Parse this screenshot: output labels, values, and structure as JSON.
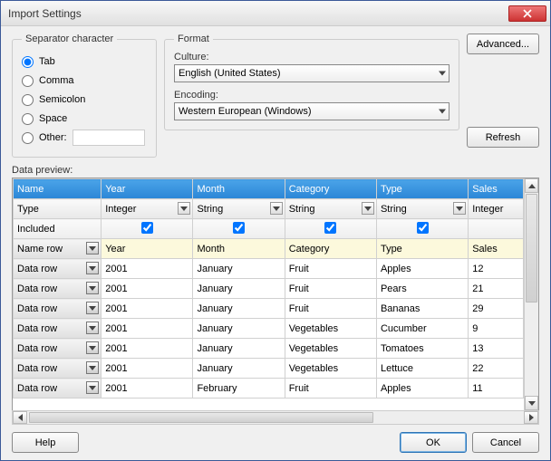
{
  "window": {
    "title": "Import Settings"
  },
  "separator": {
    "legend": "Separator character",
    "options": {
      "tab": "Tab",
      "comma": "Comma",
      "semicolon": "Semicolon",
      "space": "Space",
      "other": "Other:"
    },
    "selected": "tab",
    "other_value": ""
  },
  "format": {
    "legend": "Format",
    "culture_label": "Culture:",
    "culture_value": "English (United States)",
    "encoding_label": "Encoding:",
    "encoding_value": "Western European (Windows)"
  },
  "buttons": {
    "advanced": "Advanced...",
    "refresh": "Refresh",
    "help": "Help",
    "ok": "OK",
    "cancel": "Cancel"
  },
  "preview": {
    "label": "Data preview:",
    "type_row_label": "Type",
    "included_row_label": "Included",
    "columns": [
      {
        "name": "Name",
        "type": "",
        "included": null
      },
      {
        "name": "Year",
        "type": "Integer",
        "included": true
      },
      {
        "name": "Month",
        "type": "String",
        "included": true
      },
      {
        "name": "Category",
        "type": "String",
        "included": true
      },
      {
        "name": "Type",
        "type": "String",
        "included": true
      },
      {
        "name": "Sales",
        "type": "Integer",
        "included": true
      }
    ],
    "rowtype_labels": {
      "name": "Name row",
      "data": "Data row"
    },
    "rows": [
      {
        "rowtype": "Name row",
        "cells": [
          "Year",
          "Month",
          "Category",
          "Type",
          "Sales"
        ],
        "is_name": true
      },
      {
        "rowtype": "Data row",
        "cells": [
          "2001",
          "January",
          "Fruit",
          "Apples",
          "12"
        ]
      },
      {
        "rowtype": "Data row",
        "cells": [
          "2001",
          "January",
          "Fruit",
          "Pears",
          "21"
        ]
      },
      {
        "rowtype": "Data row",
        "cells": [
          "2001",
          "January",
          "Fruit",
          "Bananas",
          "29"
        ]
      },
      {
        "rowtype": "Data row",
        "cells": [
          "2001",
          "January",
          "Vegetables",
          "Cucumber",
          "9"
        ]
      },
      {
        "rowtype": "Data row",
        "cells": [
          "2001",
          "January",
          "Vegetables",
          "Tomatoes",
          "13"
        ]
      },
      {
        "rowtype": "Data row",
        "cells": [
          "2001",
          "January",
          "Vegetables",
          "Lettuce",
          "22"
        ]
      },
      {
        "rowtype": "Data row",
        "cells": [
          "2001",
          "February",
          "Fruit",
          "Apples",
          "11"
        ]
      }
    ]
  }
}
